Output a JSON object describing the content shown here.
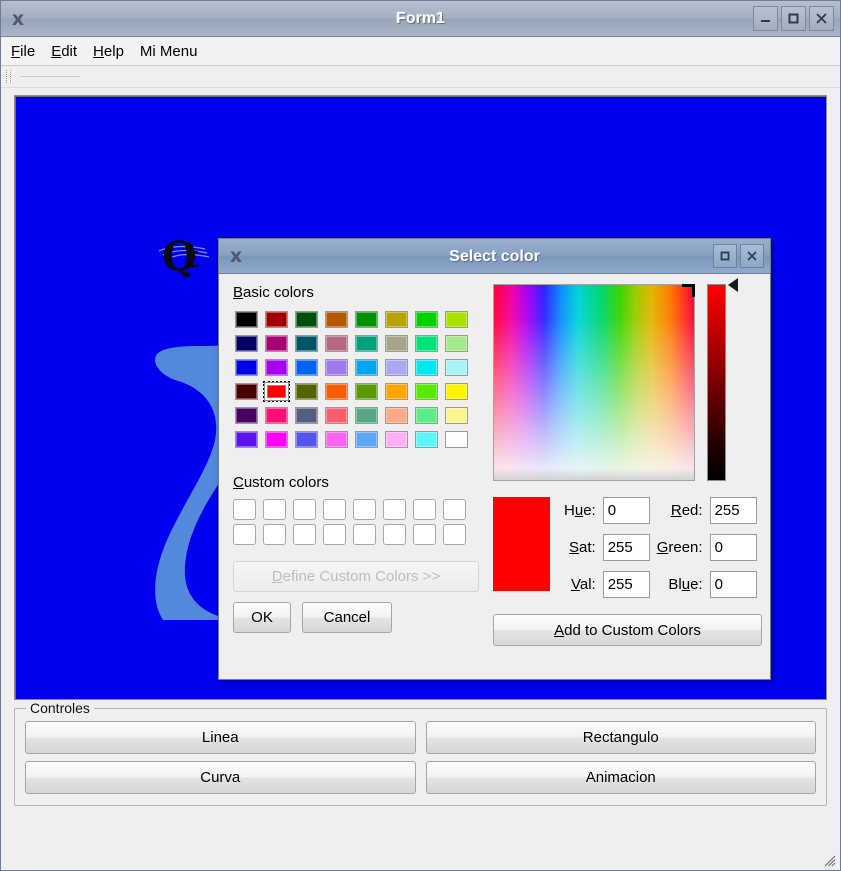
{
  "main_window": {
    "title": "Form1",
    "app_icon": "x-app-icon",
    "controls": [
      {
        "name": "minimize",
        "icon": "minimize-icon"
      },
      {
        "name": "maximize",
        "icon": "maximize-icon"
      },
      {
        "name": "close",
        "icon": "close-icon"
      }
    ],
    "menu": [
      {
        "mnemonic": "F",
        "rest": "ile"
      },
      {
        "mnemonic": "E",
        "rest": "dit"
      },
      {
        "mnemonic": "H",
        "rest": "elp"
      },
      {
        "mnemonic": "",
        "rest": "Mi Menu"
      }
    ],
    "canvas": {
      "background_color": "#0000f0",
      "blob_color": "#5289dd",
      "line_color": "#5a4a66",
      "logo": "qt-logo"
    },
    "groupbox": {
      "title": "Controles",
      "buttons": [
        {
          "label": "Linea"
        },
        {
          "label": "Rectangulo"
        },
        {
          "label": "Curva"
        },
        {
          "label": "Animacion"
        }
      ]
    }
  },
  "dialog": {
    "title": "Select color",
    "app_icon": "x-app-icon",
    "controls": [
      {
        "name": "maximize",
        "icon": "maximize-icon"
      },
      {
        "name": "close",
        "icon": "close-icon"
      }
    ],
    "basic_colors_label": {
      "mnemonic": "B",
      "rest": "asic colors"
    },
    "basic_colors": [
      "#000000",
      "#a40000",
      "#00500c",
      "#b45900",
      "#009500",
      "#b6a400",
      "#00d400",
      "#a8e400",
      "#000064",
      "#aa0078",
      "#005667",
      "#b56882",
      "#00a380",
      "#a8a488",
      "#00e47a",
      "#a4e98c",
      "#0000e8",
      "#a800f2",
      "#0064f6",
      "#a079ef",
      "#00a8f0",
      "#aaa8f4",
      "#00e8f2",
      "#a8f4f4",
      "#4a0000",
      "#ff0000",
      "#556300",
      "#fa5c00",
      "#5a9a00",
      "#ffa500",
      "#55ec00",
      "#fbf500",
      "#4a0063",
      "#ff0d78",
      "#575d80",
      "#fb5d6c",
      "#56a882",
      "#ffa884",
      "#5bed86",
      "#fcf48e",
      "#5a12ee",
      "#ff00f6",
      "#5455f0",
      "#fd62f2",
      "#5aa7f6",
      "#ffaff6",
      "#5bf6f6",
      "#ffffff"
    ],
    "selected_index": 25,
    "custom_colors_label": {
      "mnemonic": "C",
      "rest": "ustom colors"
    },
    "custom_colors": [
      "#ffffff",
      "#ffffff",
      "#ffffff",
      "#ffffff",
      "#ffffff",
      "#ffffff",
      "#ffffff",
      "#ffffff",
      "#ffffff",
      "#ffffff",
      "#ffffff",
      "#ffffff",
      "#ffffff",
      "#ffffff",
      "#ffffff",
      "#ffffff"
    ],
    "define_custom_button": {
      "pre": "D",
      "mnemonic": "D",
      "label": "Define Custom Colors >>",
      "rest": "efine Custom Colors >>",
      "enabled": false
    },
    "ok_button": "OK",
    "cancel_button": "Cancel",
    "add_button": {
      "mnemonic": "A",
      "rest": "dd to Custom Colors"
    },
    "preview_color": "#ff0000",
    "fields": {
      "hue": {
        "pre": "H",
        "mnemonic": "u",
        "post": "e:",
        "value": "0"
      },
      "sat": {
        "pre": "",
        "mnemonic": "S",
        "post": "at:",
        "value": "255"
      },
      "val": {
        "pre": "",
        "mnemonic": "V",
        "post": "al:",
        "value": "255"
      },
      "red": {
        "pre": "",
        "mnemonic": "R",
        "post": "ed:",
        "value": "255"
      },
      "green": {
        "pre": "",
        "mnemonic": "G",
        "post": "reen:",
        "value": "0"
      },
      "blue": {
        "pre": "Bl",
        "mnemonic": "u",
        "post": "e:",
        "value": "0"
      }
    }
  }
}
